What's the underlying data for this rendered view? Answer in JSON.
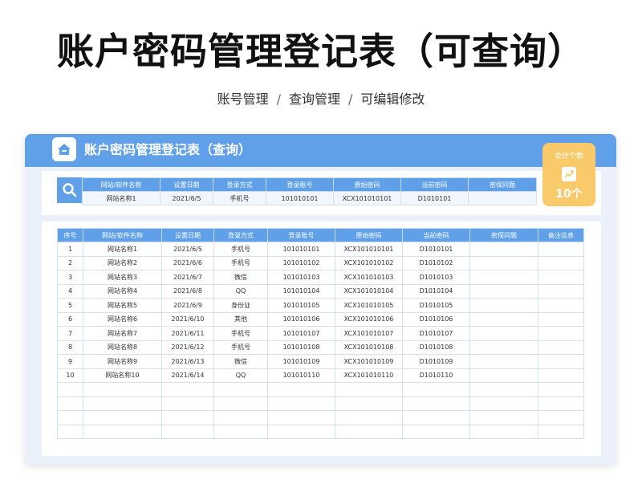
{
  "header": {
    "title": "账户密码管理登记表（可查询）",
    "breadcrumb": [
      "账号管理",
      "查询管理",
      "可编辑修改"
    ],
    "separator": "/"
  },
  "card": {
    "title": "账户密码管理登记表（查询）"
  },
  "summary": {
    "label": "合计个数",
    "value": "10个"
  },
  "search": {
    "columns": [
      "网站/软件名称",
      "设置日期",
      "登录方式",
      "登录账号",
      "原始密码",
      "当前密码",
      "密保问题"
    ],
    "row": [
      "网站名称1",
      "2021/6/5",
      "手机号",
      "101010101",
      "XCX101010101",
      "D1010101",
      ""
    ]
  },
  "table": {
    "columns": [
      "序号",
      "网站/软件名称",
      "设置日期",
      "登录方式",
      "登录账号",
      "原始密码",
      "当前密码",
      "密保问题",
      "备注信息"
    ],
    "rows": [
      [
        "1",
        "网站名称1",
        "2021/6/5",
        "手机号",
        "101010101",
        "XCX101010101",
        "D1010101",
        "",
        ""
      ],
      [
        "2",
        "网站名称2",
        "2021/6/6",
        "手机号",
        "101010102",
        "XCX101010102",
        "D1010102",
        "",
        ""
      ],
      [
        "3",
        "网站名称3",
        "2021/6/7",
        "微信",
        "101010103",
        "XCX101010103",
        "D1010103",
        "",
        ""
      ],
      [
        "4",
        "网站名称4",
        "2021/6/8",
        "QQ",
        "101010104",
        "XCX101010104",
        "D1010104",
        "",
        ""
      ],
      [
        "5",
        "网站名称5",
        "2021/6/9",
        "身份证",
        "101010105",
        "XCX101010105",
        "D1010105",
        "",
        ""
      ],
      [
        "6",
        "网站名称6",
        "2021/6/10",
        "其他",
        "101010106",
        "XCX101010106",
        "D1010106",
        "",
        ""
      ],
      [
        "7",
        "网站名称7",
        "2021/6/11",
        "手机号",
        "101010107",
        "XCX101010107",
        "D1010107",
        "",
        ""
      ],
      [
        "8",
        "网站名称8",
        "2021/6/12",
        "手机号",
        "101010108",
        "XCX101010108",
        "D1010108",
        "",
        ""
      ],
      [
        "9",
        "网站名称9",
        "2021/6/13",
        "微信",
        "101010109",
        "XCX101010109",
        "D1010109",
        "",
        ""
      ],
      [
        "10",
        "网站名称10",
        "2021/6/14",
        "QQ",
        "101010110",
        "XCX101010110",
        "D1010110",
        "",
        ""
      ],
      [
        "",
        "",
        "",
        "",
        "",
        "",
        "",
        "",
        ""
      ],
      [
        "",
        "",
        "",
        "",
        "",
        "",
        "",
        "",
        ""
      ],
      [
        "",
        "",
        "",
        "",
        "",
        "",
        "",
        "",
        ""
      ],
      [
        "",
        "",
        "",
        "",
        "",
        "",
        "",
        "",
        ""
      ]
    ]
  },
  "icons": {
    "home": "home-icon",
    "search": "search-icon",
    "trend": "trend-chart-icon"
  },
  "colors": {
    "accent": "#5fa0e8",
    "summary_card": "#f9ca6a",
    "panel_bg": "#eaf1fb"
  }
}
